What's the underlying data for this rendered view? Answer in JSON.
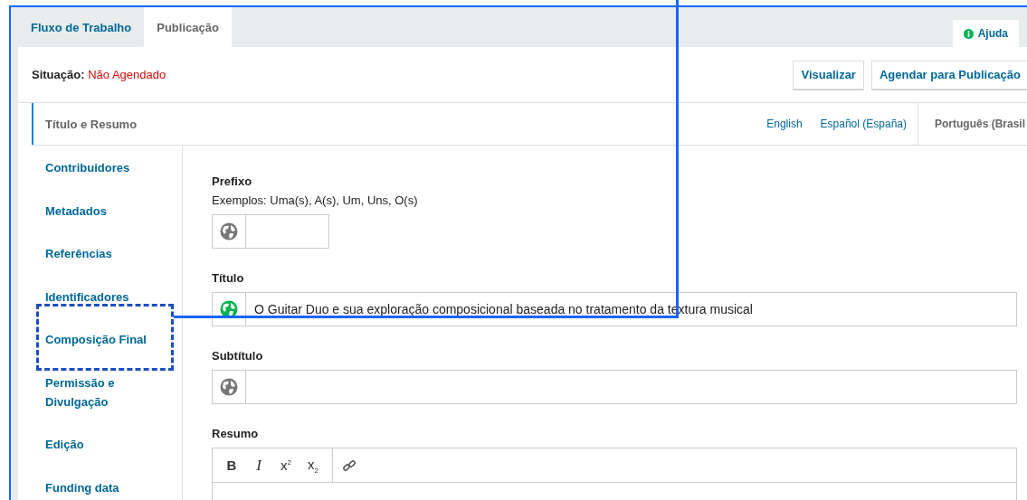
{
  "tabs": [
    {
      "label": "Fluxo de Trabalho",
      "selected": false
    },
    {
      "label": "Publicação",
      "selected": true
    }
  ],
  "help": {
    "label": "Ajuda"
  },
  "status": {
    "label": "Situação:",
    "value": "Não Agendado"
  },
  "actions": [
    "Visualizar",
    "Agendar para Publicação"
  ],
  "section_tab": {
    "label": "Título e Resumo",
    "selected": true
  },
  "languages": [
    {
      "label": "English",
      "selected": false
    },
    {
      "label": "Español (España)",
      "selected": false
    },
    {
      "label": "Português (Brasil",
      "selected": true
    }
  ],
  "sidebar": {
    "items": [
      "Contribuidores",
      "Metadados",
      "Referências",
      "Identificadores",
      "Composição Final",
      "Permissão e Divulgação",
      "Edição",
      "Funding data"
    ]
  },
  "form": {
    "fields": [
      {
        "kind": "short",
        "label": "Prefixo",
        "description": "Exemplos: Uma(s), A(s), Um, Uns, O(s)",
        "complete": false
      },
      {
        "kind": "text",
        "label": "Título",
        "value": "O Guitar Duo e sua exploração composicional baseada no tratamento da textura musical",
        "complete": true
      },
      {
        "kind": "text",
        "label": "Subtítulo",
        "complete": false
      },
      {
        "kind": "rich",
        "label": "Resumo",
        "toolbar": [
          "B",
          "I",
          "x$^{2}$",
          "x$_{2}$"
        ]
      }
    ]
  }
}
